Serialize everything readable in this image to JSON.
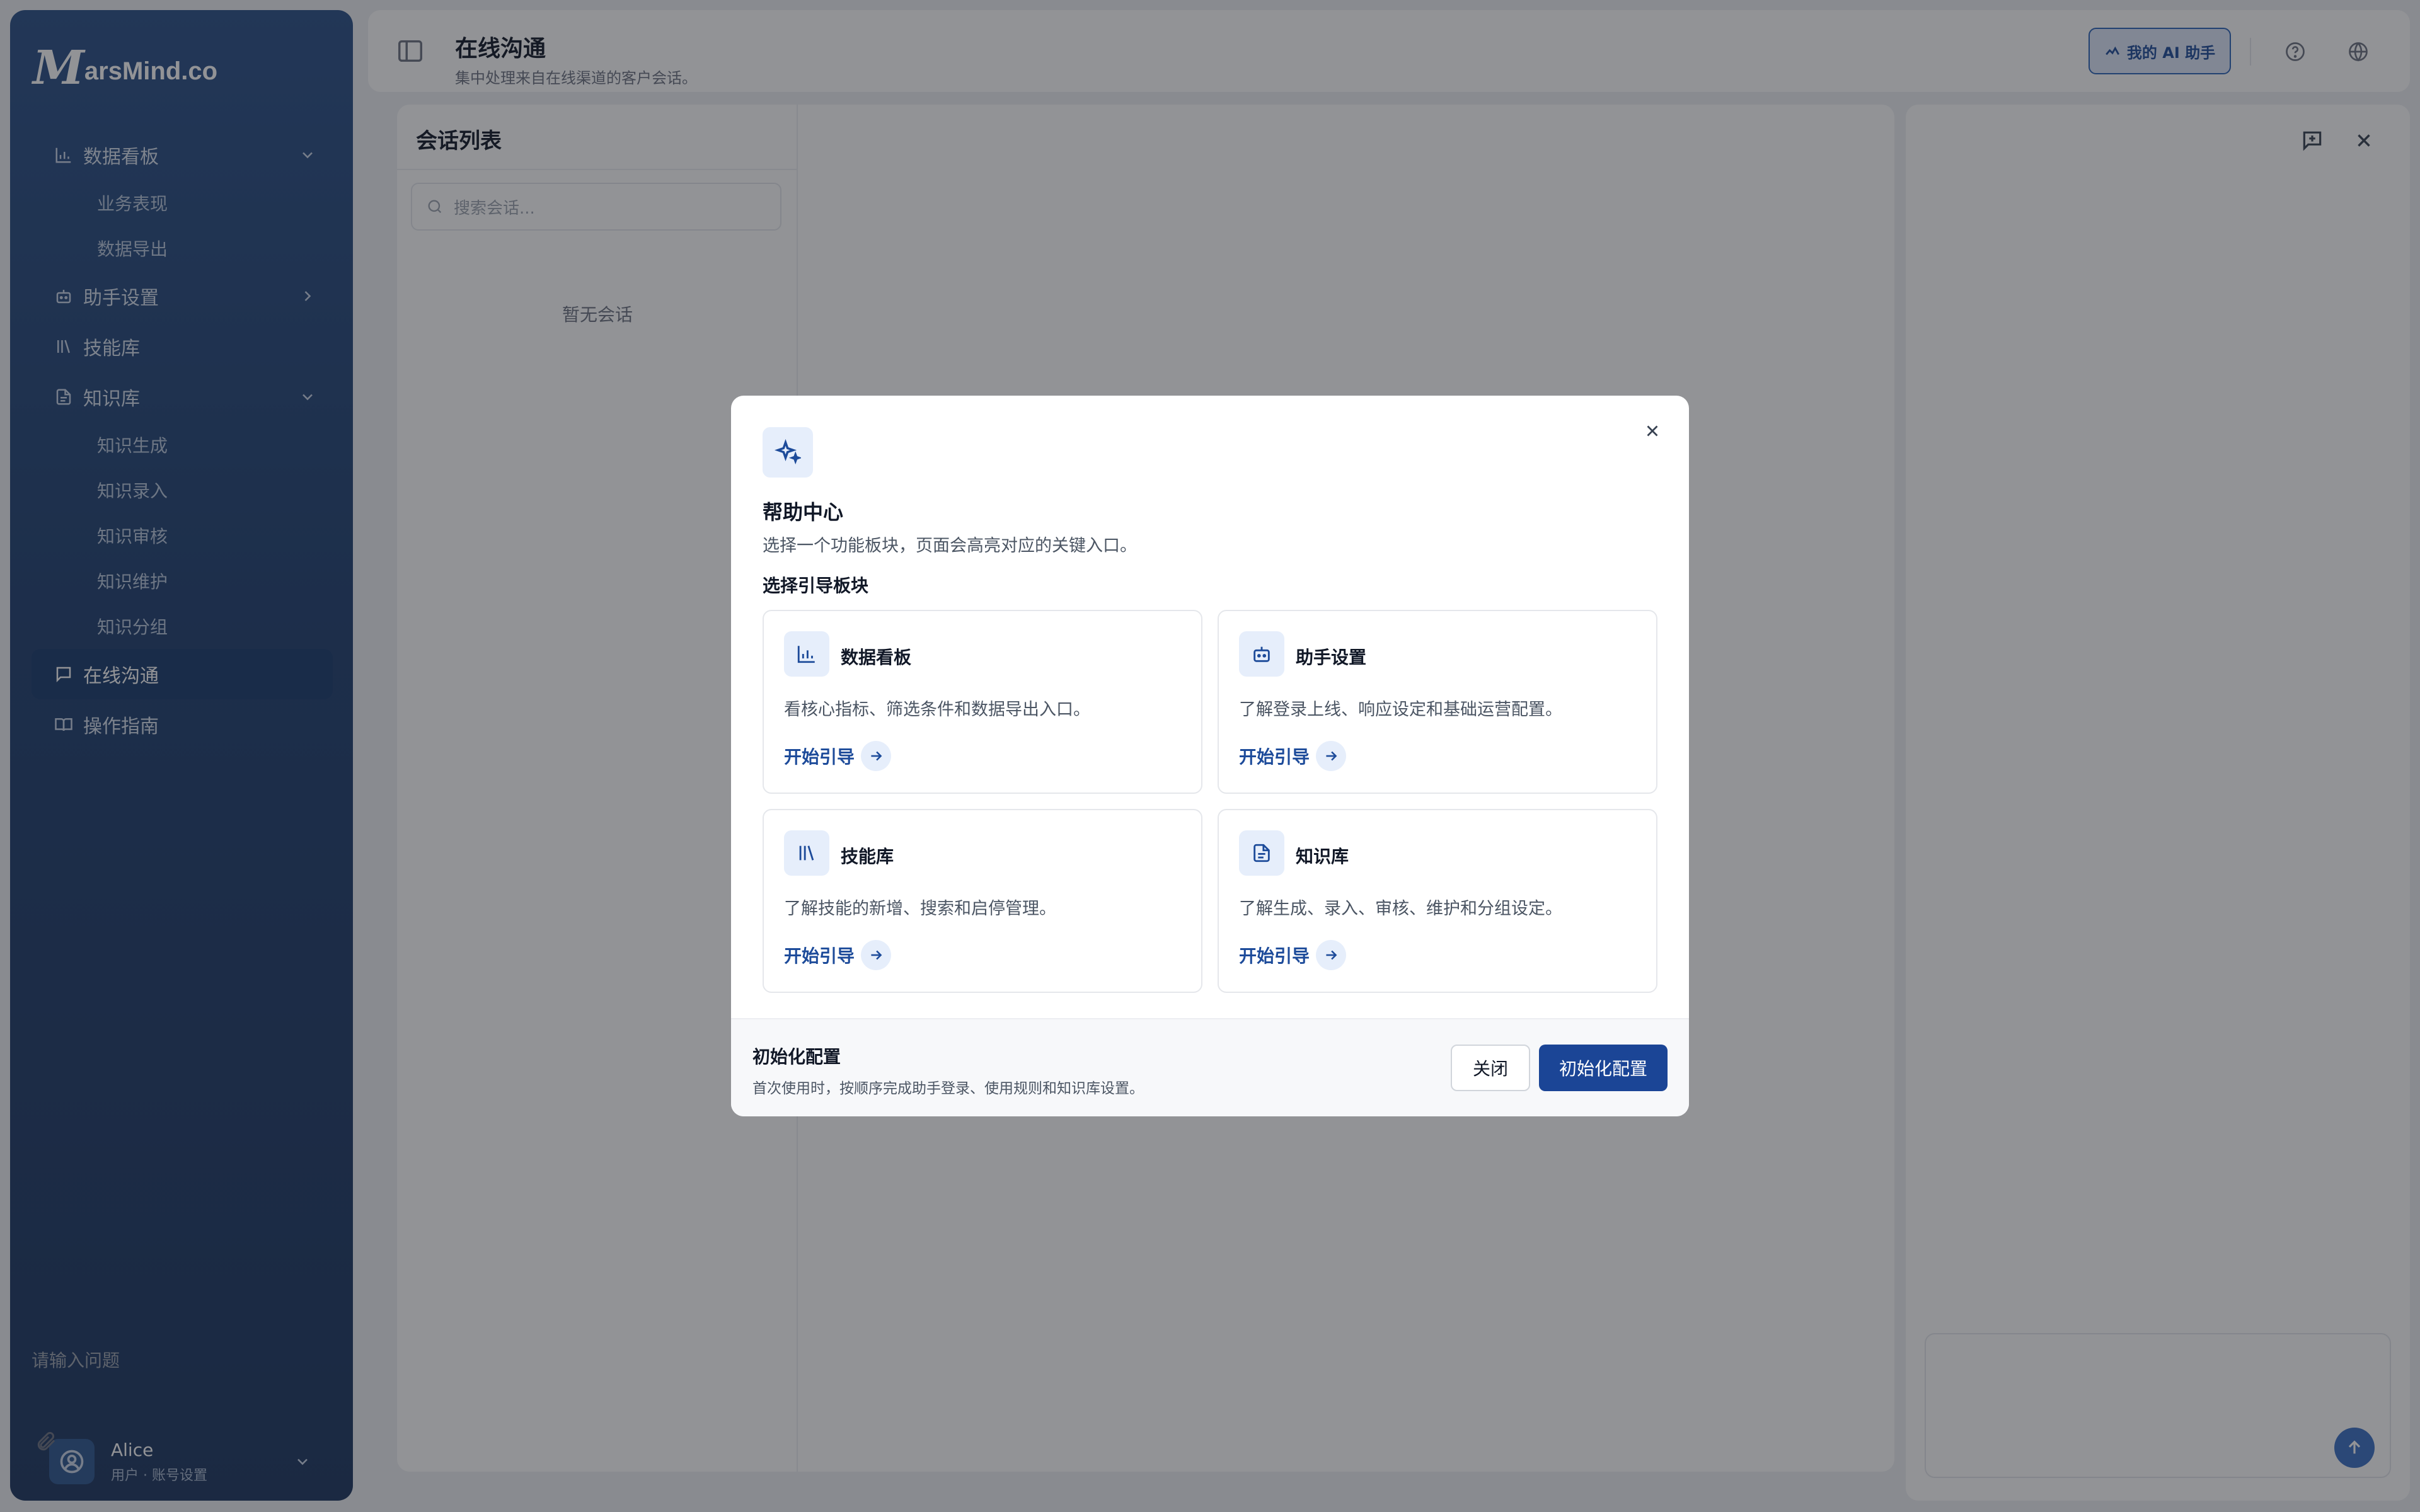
{
  "brand": {
    "logo_mark": "M",
    "logo_text": "arsMind.co"
  },
  "sidebar": {
    "items": [
      {
        "label": "数据看板",
        "icon": "bar-chart-icon",
        "expanded": true,
        "children": [
          {
            "label": "业务表现"
          },
          {
            "label": "数据导出"
          }
        ]
      },
      {
        "label": "助手设置",
        "icon": "robot-icon",
        "expanded": false
      },
      {
        "label": "技能库",
        "icon": "library-icon"
      },
      {
        "label": "知识库",
        "icon": "document-icon",
        "expanded": true,
        "children": [
          {
            "label": "知识生成"
          },
          {
            "label": "知识录入"
          },
          {
            "label": "知识审核"
          },
          {
            "label": "知识维护"
          },
          {
            "label": "知识分组"
          }
        ]
      },
      {
        "label": "在线沟通",
        "icon": "chat-icon",
        "active": true
      },
      {
        "label": "操作指南",
        "icon": "book-icon"
      }
    ]
  },
  "user": {
    "name": "Alice",
    "subtitle": "用户 · 账号设置"
  },
  "header": {
    "title": "在线沟通",
    "subtitle": "集中处理来自在线渠道的客户会话。",
    "ai_button_label": "我的 AI 助手"
  },
  "conversations": {
    "title": "会话列表",
    "search_placeholder": "搜索会话...",
    "empty_text": "暂无会话"
  },
  "assistant_panel": {
    "input_placeholder": "请输入问题"
  },
  "modal": {
    "title": "帮助中心",
    "subtitle": "选择一个功能板块，页面会高亮对应的关键入口。",
    "section_title": "选择引导板块",
    "cards": [
      {
        "title": "数据看板",
        "desc": "看核心指标、筛选条件和数据导出入口。",
        "link": "开始引导",
        "icon": "bar-chart-icon"
      },
      {
        "title": "助手设置",
        "desc": "了解登录上线、响应设定和基础运营配置。",
        "link": "开始引导",
        "icon": "robot-icon"
      },
      {
        "title": "技能库",
        "desc": "了解技能的新增、搜索和启停管理。",
        "link": "开始引导",
        "icon": "library-icon"
      },
      {
        "title": "知识库",
        "desc": "了解生成、录入、审核、维护和分组设定。",
        "link": "开始引导",
        "icon": "document-icon"
      }
    ],
    "footer": {
      "title": "初始化配置",
      "subtitle": "首次使用时，按顺序完成助手登录、使用规则和知识库设置。",
      "close_label": "关闭",
      "init_label": "初始化配置"
    }
  },
  "colors": {
    "sidebar": "#1f3f6f",
    "accent": "#1b4596",
    "overlay": "rgba(28,30,36,0.48)"
  }
}
